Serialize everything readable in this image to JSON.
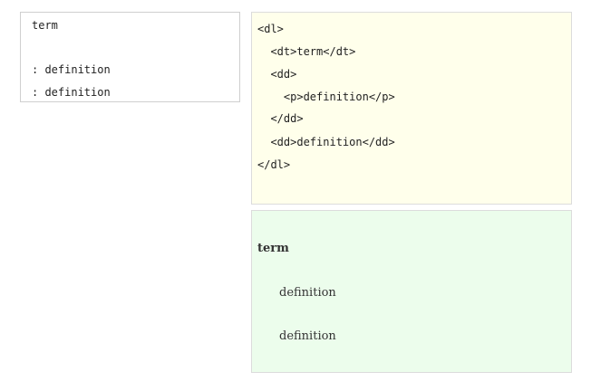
{
  "markdown": {
    "lines": [
      "term",
      ": definition",
      ": definition"
    ]
  },
  "html_source": {
    "lines": [
      "<dl>",
      "  <dt>term</dt>",
      "  <dd>",
      "    <p>definition</p>",
      "  </dd>",
      "  <dd>definition</dd>",
      "</dl>"
    ]
  },
  "preview": {
    "term": "term",
    "definitions": [
      "definition",
      "definition"
    ]
  },
  "colors": {
    "html_source_bg": "#ffffeb",
    "preview_bg": "#ecfdec",
    "border": "#dcdcdc"
  }
}
